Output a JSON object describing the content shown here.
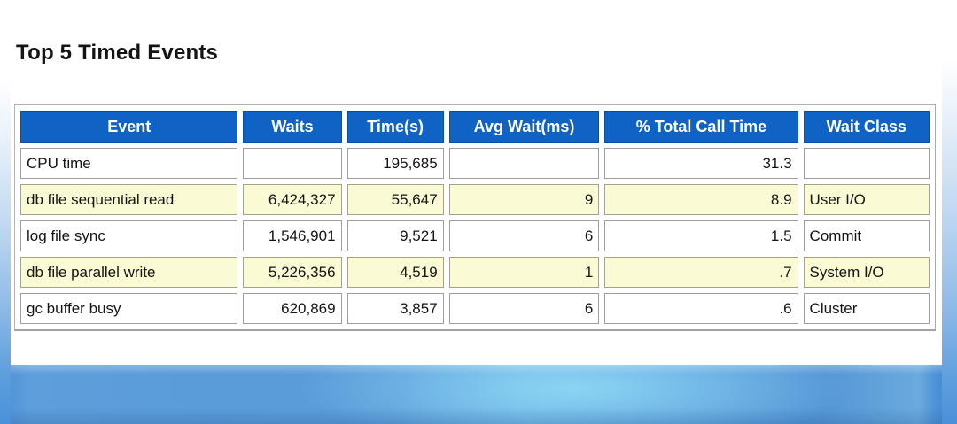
{
  "page": {
    "title": "Top 5 Timed Events"
  },
  "table": {
    "columns": [
      {
        "label": "Event",
        "align": "left"
      },
      {
        "label": "Waits",
        "align": "right"
      },
      {
        "label": "Time(s)",
        "align": "right"
      },
      {
        "label": "Avg Wait(ms)",
        "align": "right"
      },
      {
        "label": "% Total Call Time",
        "align": "right"
      },
      {
        "label": "Wait Class",
        "align": "left"
      }
    ],
    "rows": [
      [
        "CPU time",
        "",
        "195,685",
        "",
        "31.3",
        ""
      ],
      [
        "db file sequential read",
        "6,424,327",
        "55,647",
        "9",
        "8.9",
        "User I/O"
      ],
      [
        "log file sync",
        "1,546,901",
        "9,521",
        "6",
        "1.5",
        "Commit"
      ],
      [
        "db file parallel write",
        "5,226,356",
        "4,519",
        "1",
        ".7",
        "System I/O"
      ],
      [
        "gc buffer busy",
        "620,869",
        "3,857",
        "6",
        ".6",
        "Cluster"
      ]
    ]
  },
  "colors": {
    "header_bg": "#0e63c5",
    "header_text": "#ffffff",
    "alt_row_bg": "#fafad4",
    "cell_border": "#9e9e9e",
    "band_blue": "#5b9dda",
    "band_glow": "#92dcf7",
    "edge_blue": "#4a90d9"
  }
}
